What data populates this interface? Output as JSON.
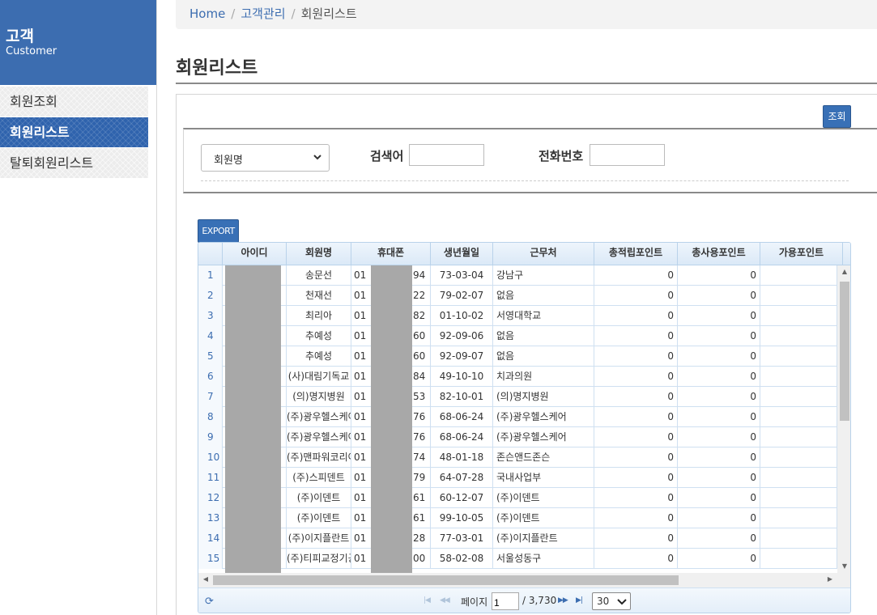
{
  "sidebar": {
    "title": "고객",
    "subtitle": "Customer",
    "items": [
      {
        "label": "회원조회",
        "active": false
      },
      {
        "label": "회원리스트",
        "active": true
      },
      {
        "label": "탈퇴회원리스트",
        "active": false
      }
    ]
  },
  "breadcrumb": {
    "home": "Home",
    "section": "고객관리",
    "current": "회원리스트"
  },
  "page_title": "회원리스트",
  "search": {
    "query_button": "조회",
    "select_value": "회원명",
    "keyword_label": "검색어",
    "keyword_value": "",
    "phone_label": "전화번호",
    "phone_value": ""
  },
  "export_button": "EXPORT",
  "grid": {
    "columns": [
      "아이디",
      "회원명",
      "휴대폰",
      "생년월일",
      "근무처",
      "총적립포인트",
      "총사용포인트",
      "가용포인트"
    ],
    "rows": [
      {
        "no": "1",
        "name": "송문선",
        "phone_pre": "01",
        "phone_suf": "94",
        "birth": "73-03-04",
        "work": "강남구",
        "earned": "0",
        "used": "0"
      },
      {
        "no": "2",
        "name": "천재선",
        "phone_pre": "01",
        "phone_suf": "22",
        "birth": "79-02-07",
        "work": "없음",
        "earned": "0",
        "used": "0"
      },
      {
        "no": "3",
        "name": "최리아",
        "phone_pre": "01",
        "phone_suf": "82",
        "birth": "01-10-02",
        "work": "서영대학교",
        "earned": "0",
        "used": "0"
      },
      {
        "no": "4",
        "name": "추예성",
        "phone_pre": "01",
        "phone_suf": "60",
        "birth": "92-09-06",
        "work": "없음",
        "earned": "0",
        "used": "0"
      },
      {
        "no": "5",
        "name": "추예성",
        "phone_pre": "01",
        "phone_suf": "60",
        "birth": "92-09-07",
        "work": "없음",
        "earned": "0",
        "used": "0"
      },
      {
        "no": "6",
        "name": "(사)대림기독교",
        "phone_pre": "01",
        "phone_suf": "84",
        "birth": "49-10-10",
        "work": "치과의원",
        "earned": "0",
        "used": "0"
      },
      {
        "no": "7",
        "name": "(의)명지병원",
        "phone_pre": "01",
        "phone_suf": "53",
        "birth": "82-10-01",
        "work": "(의)명지병원",
        "earned": "0",
        "used": "0"
      },
      {
        "no": "8",
        "name": "(주)광우헬스케어",
        "phone_pre": "01",
        "phone_suf": "76",
        "birth": "68-06-24",
        "work": "(주)광우헬스케어",
        "earned": "0",
        "used": "0"
      },
      {
        "no": "9",
        "name": "(주)광우헬스케어",
        "phone_pre": "01",
        "phone_suf": "76",
        "birth": "68-06-24",
        "work": "(주)광우헬스케어",
        "earned": "0",
        "used": "0"
      },
      {
        "no": "10",
        "name": "(주)맨파워코리아",
        "phone_pre": "01",
        "phone_suf": "74",
        "birth": "48-01-18",
        "work": "존슨앤드존슨",
        "earned": "0",
        "used": "0"
      },
      {
        "no": "11",
        "name": "(주)스피덴트",
        "phone_pre": "01",
        "phone_suf": "79",
        "birth": "64-07-28",
        "work": "국내사업부",
        "earned": "0",
        "used": "0"
      },
      {
        "no": "12",
        "name": "(주)이덴트",
        "phone_pre": "01",
        "phone_suf": "61",
        "birth": "60-12-07",
        "work": "(주)이덴트",
        "earned": "0",
        "used": "0"
      },
      {
        "no": "13",
        "name": "(주)이덴트",
        "phone_pre": "01",
        "phone_suf": "61",
        "birth": "99-10-05",
        "work": "(주)이덴트",
        "earned": "0",
        "used": "0"
      },
      {
        "no": "14",
        "name": "(주)이지플란트",
        "phone_pre": "01",
        "phone_suf": "28",
        "birth": "77-03-01",
        "work": "(주)이지플란트",
        "earned": "0",
        "used": "0"
      },
      {
        "no": "15",
        "name": "(주)티피교정기공",
        "phone_pre": "01",
        "phone_suf": "00",
        "birth": "58-02-08",
        "work": "서울성동구",
        "earned": "0",
        "used": "0"
      }
    ]
  },
  "pager": {
    "page_label": "페이지",
    "page_value": "1",
    "total": "/ 3,730",
    "page_size": "30"
  },
  "colors": {
    "brand": "#3c6db0",
    "button": "#3870b6",
    "grid_border": "#b9d2ea",
    "mask": "#a8a8a8"
  }
}
